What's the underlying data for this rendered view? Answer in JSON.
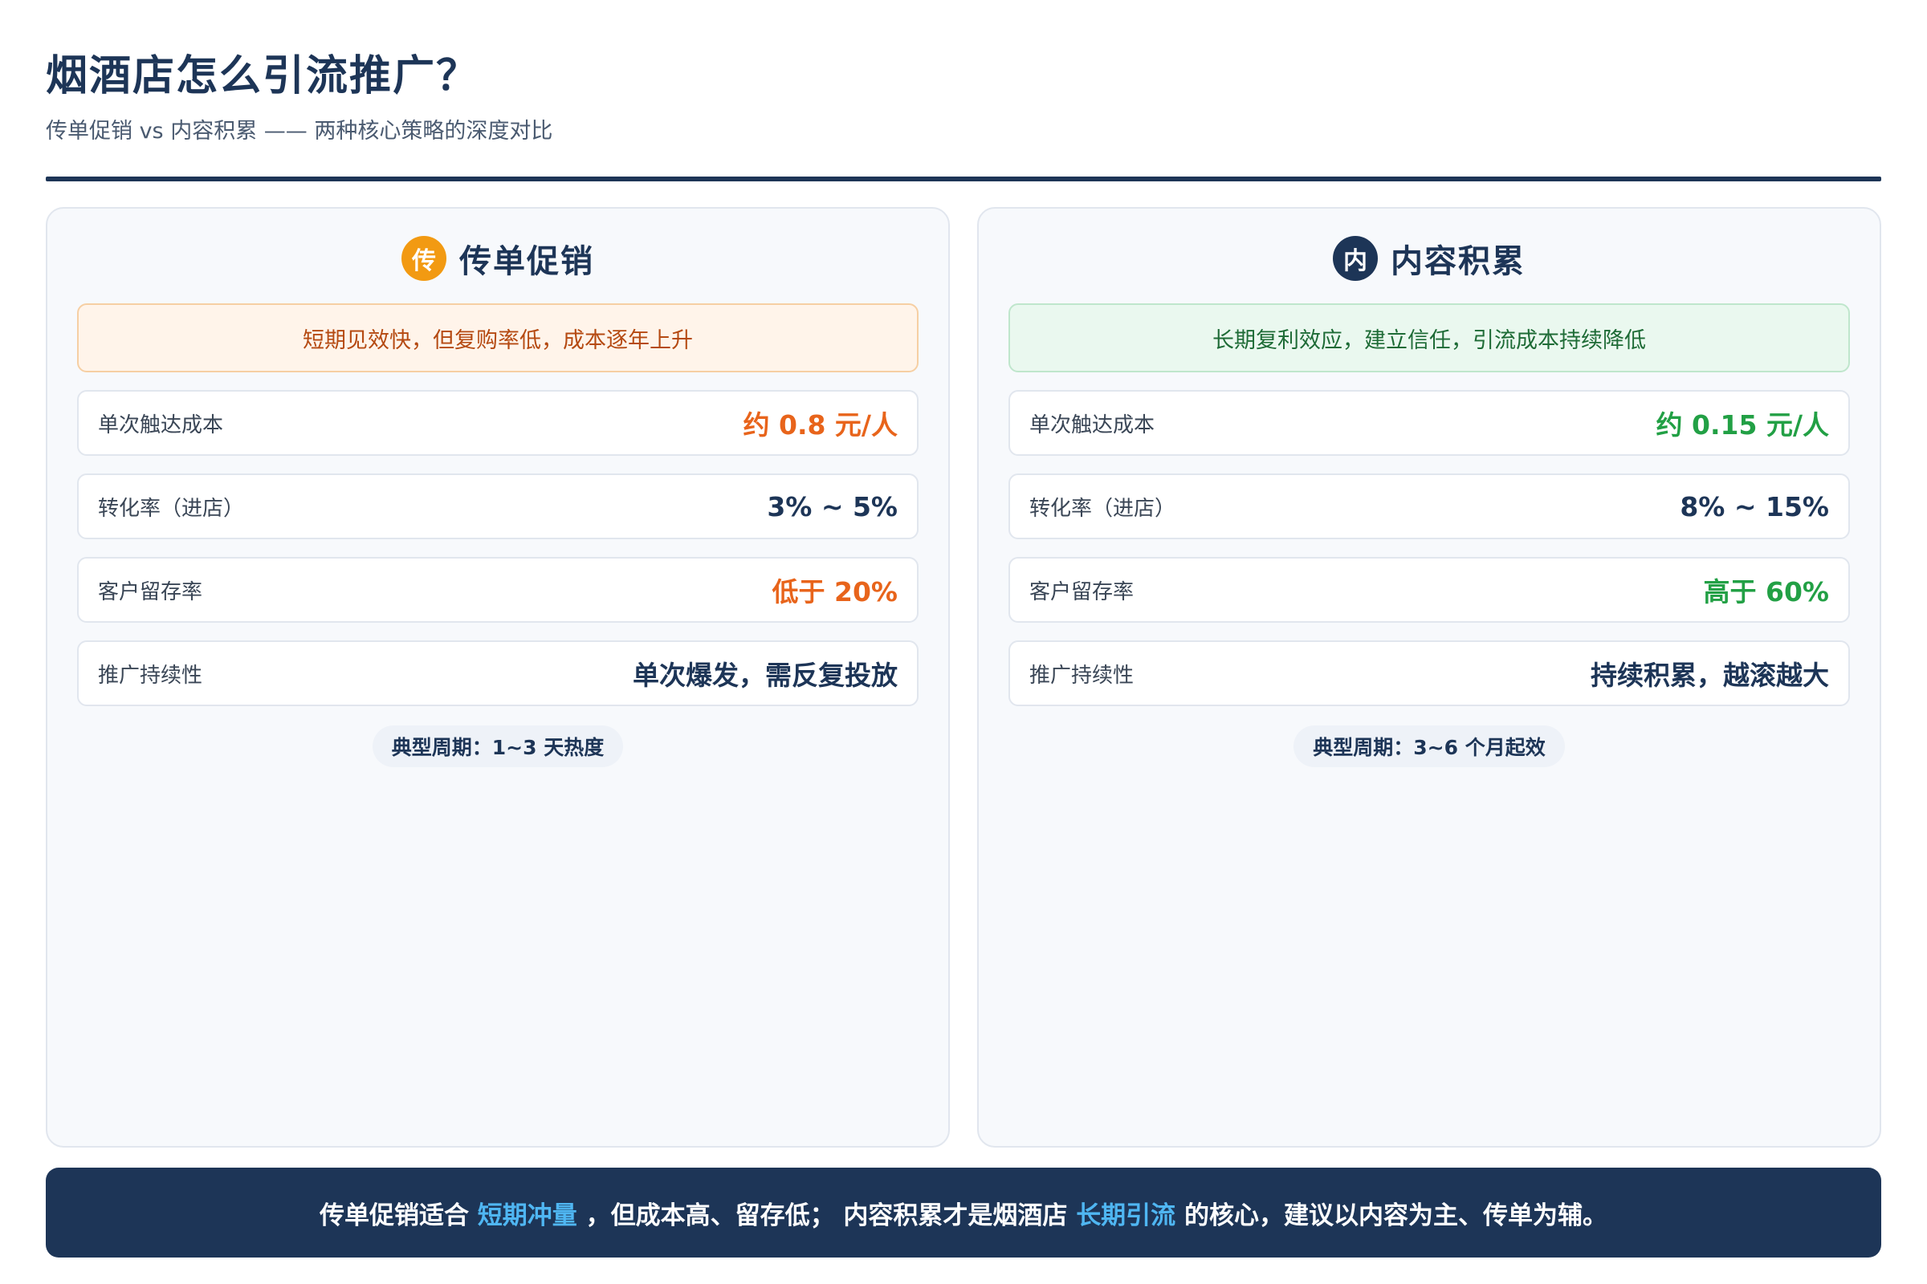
{
  "header": {
    "title": "烟酒店怎么引流推广？",
    "subtitle": "传单促销 vs 内容积累 —— 两种核心策略的深度对比"
  },
  "colors": {
    "navy": "#1d3557",
    "orange_accent": "#e8641b",
    "green_accent": "#22a045",
    "badge_orange": "#f29a12",
    "highlight_blue": "#4fb6f2"
  },
  "left_card": {
    "badge": "传",
    "title": "传单促销",
    "note": "短期见效快，但复购率低，成本逐年上升",
    "metrics": [
      {
        "label": "单次触达成本",
        "value": "约 0.8 元/人"
      },
      {
        "label": "转化率（进店）",
        "value": "3% ~ 5%"
      },
      {
        "label": "客户留存率",
        "value": "低于 20%"
      },
      {
        "label": "推广持续性",
        "value": "单次爆发，需反复投放"
      }
    ],
    "cycle": "典型周期：1~3 天热度"
  },
  "right_card": {
    "badge": "内",
    "title": "内容积累",
    "note": "长期复利效应，建立信任，引流成本持续降低",
    "metrics": [
      {
        "label": "单次触达成本",
        "value": "约 0.15 元/人"
      },
      {
        "label": "转化率（进店）",
        "value": "8% ~ 15%"
      },
      {
        "label": "客户留存率",
        "value": "高于 60%"
      },
      {
        "label": "推广持续性",
        "value": "持续积累，越滚越大"
      }
    ],
    "cycle": "典型周期：3~6 个月起效"
  },
  "footer": {
    "part1": "传单促销适合",
    "highlight1": "短期冲量",
    "part2": "，但成本高、留存低； 内容积累才是烟酒店",
    "highlight2": "长期引流",
    "part3": "的核心，建议以内容为主、传单为辅。"
  }
}
